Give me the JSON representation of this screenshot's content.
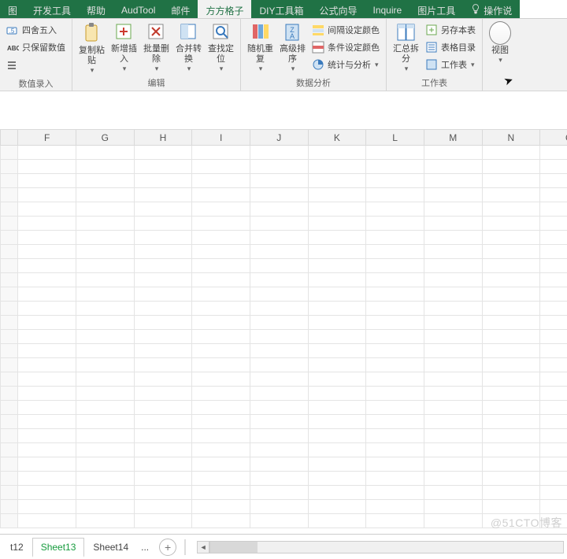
{
  "tabs": {
    "items": [
      {
        "label": "图",
        "active": false
      },
      {
        "label": "开发工具",
        "active": false
      },
      {
        "label": "帮助",
        "active": false
      },
      {
        "label": "AudTool",
        "active": false
      },
      {
        "label": "邮件",
        "active": false
      },
      {
        "label": "方方格子",
        "active": true
      },
      {
        "label": "DIY工具箱",
        "active": false
      },
      {
        "label": "公式向导",
        "active": false
      },
      {
        "label": "Inquire",
        "active": false
      },
      {
        "label": "图片工具",
        "active": false
      },
      {
        "label": "操作说",
        "active": false
      }
    ]
  },
  "ribbon": {
    "group1": {
      "label": "数值录入",
      "btn1": "四舍五入",
      "btn2": "只保留数值"
    },
    "group2": {
      "label": "编辑",
      "copy": "复制粘\n贴",
      "insert": "新增插\n入",
      "batchdel": "批量删\n除",
      "merge": "合并转\n换",
      "find": "查找定\n位"
    },
    "group3": {
      "label": "数据分析",
      "random": "随机重\n复",
      "sort": "高级排\n序",
      "interval": "间隔设定颜色",
      "cond": "条件设定颜色",
      "stat": "统计与分析"
    },
    "group4": {
      "label": "工作表",
      "split": "汇总拆\n分",
      "save": "另存本表",
      "toc": "表格目录",
      "sheet": "工作表"
    },
    "group5": {
      "label": "",
      "view": "视图"
    }
  },
  "columns": [
    "F",
    "G",
    "H",
    "I",
    "J",
    "K",
    "L",
    "M",
    "N",
    "O"
  ],
  "sheets": {
    "prev": "t12",
    "active": "Sheet13",
    "next": "Sheet14",
    "more": "..."
  },
  "watermark": "@51CTO博客"
}
